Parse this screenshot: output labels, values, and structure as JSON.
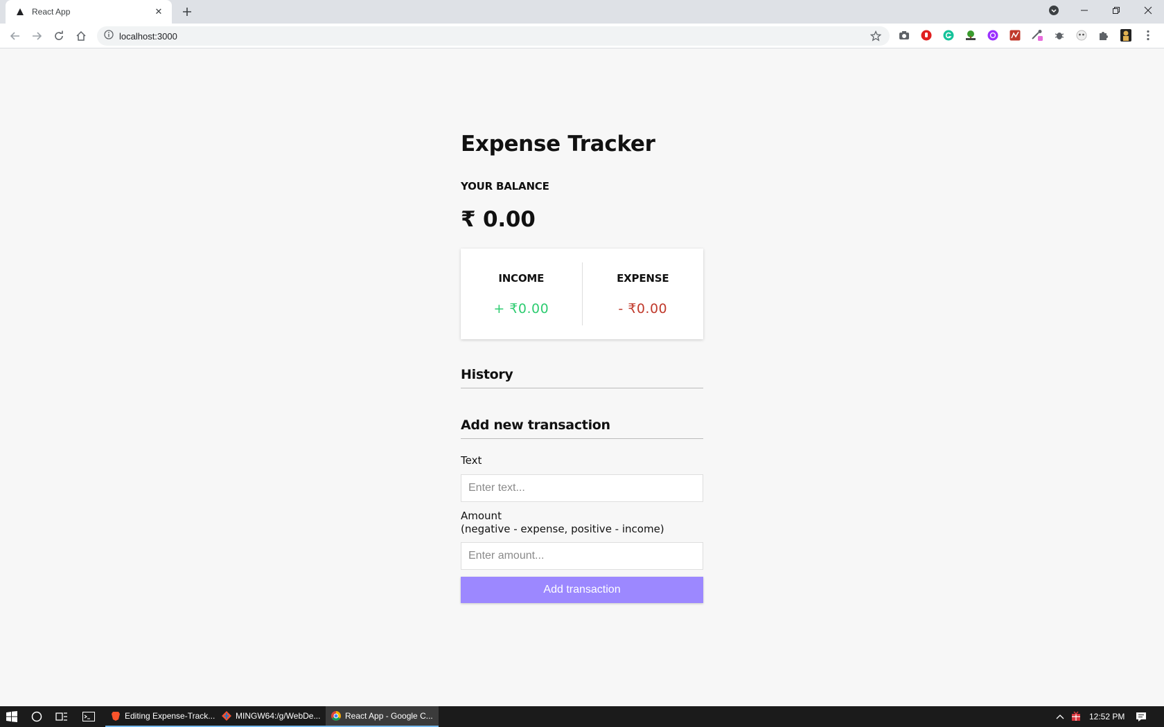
{
  "browser": {
    "tab_title": "React App",
    "url": "localhost:3000"
  },
  "app": {
    "title": "Expense Tracker",
    "balance_label": "YOUR BALANCE",
    "balance_value": "₹ 0.00",
    "income_label": "INCOME",
    "income_value": "+ ₹0.00",
    "expense_label": "EXPENSE",
    "expense_value": "- ₹0.00",
    "history_heading": "History",
    "add_heading": "Add new transaction",
    "text_label": "Text",
    "text_placeholder": "Enter text...",
    "amount_label": "Amount",
    "amount_hint": "(negative - expense, positive - income)",
    "amount_placeholder": "Enter amount...",
    "submit_label": "Add transaction"
  },
  "colors": {
    "income": "#2ecc71",
    "expense": "#c0392b",
    "button": "#9c88ff"
  },
  "taskbar": {
    "apps": [
      {
        "label": "Editing Expense-Track...",
        "icon": "brave-icon"
      },
      {
        "label": "MINGW64:/g/WebDe...",
        "icon": "git-bash-icon"
      },
      {
        "label": "React App - Google C...",
        "icon": "chrome-icon",
        "active": true
      }
    ],
    "time": "12:52 PM"
  }
}
